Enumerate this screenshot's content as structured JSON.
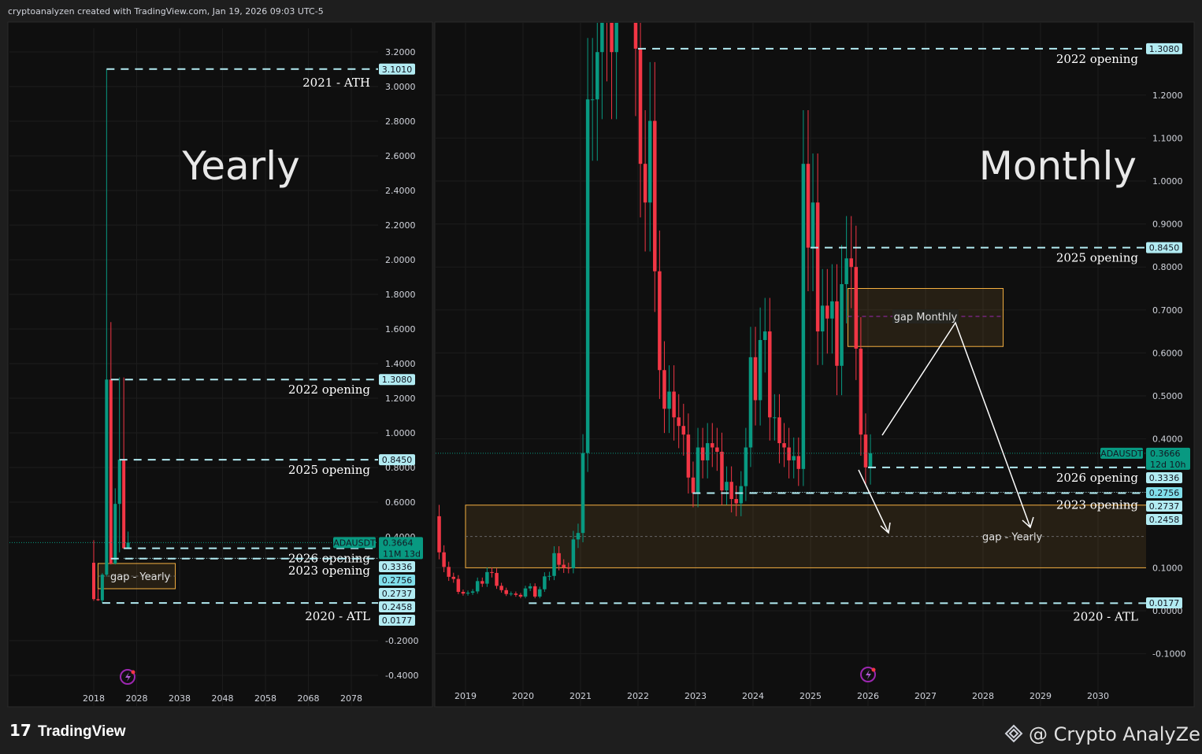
{
  "header": {
    "credit": "cryptoanalyzen created with TradingView.com, Jan 19, 2026 09:03 UTC-5"
  },
  "footer": {
    "logo": "TradingView",
    "watermark": "@ Crypto AnalyZen"
  },
  "colors": {
    "up": "#089981",
    "down": "#f23645",
    "level_line": "#b2ebf2",
    "tag_bg": "#b2ebf2",
    "symbol_tag": "#089981",
    "gap_box": "#f5b041",
    "gap_mid": "#9c27b0"
  },
  "chart_data": [
    {
      "type": "candlestick",
      "title": "Yearly",
      "symbol": "ADAUSDT",
      "timeframe": "1Y",
      "xlim": [
        2016,
        2086
      ],
      "ylim": [
        -0.45,
        3.3
      ],
      "x_ticks": [
        "2018",
        "2028",
        "2038",
        "2048",
        "2058",
        "2068",
        "2078"
      ],
      "y_ticks": [
        "3.2000",
        "3.0000",
        "2.8000",
        "2.6000",
        "2.4000",
        "2.2000",
        "2.0000",
        "1.8000",
        "1.6000",
        "1.4000",
        "1.2000",
        "1.0000",
        "0.8000",
        "0.6000",
        "0.4000",
        "-0.2000",
        "-0.4000"
      ],
      "candles": [
        {
          "t": 2018,
          "o": 0.25,
          "h": 0.38,
          "l": 0.03,
          "c": 0.04
        },
        {
          "t": 2019,
          "o": 0.04,
          "h": 0.1,
          "l": 0.03,
          "c": 0.033
        },
        {
          "t": 2020,
          "o": 0.033,
          "h": 0.19,
          "l": 0.0177,
          "c": 0.181
        },
        {
          "t": 2021,
          "o": 0.181,
          "h": 3.101,
          "l": 0.17,
          "c": 1.308
        },
        {
          "t": 2022,
          "o": 1.308,
          "h": 1.64,
          "l": 0.24,
          "c": 0.245
        },
        {
          "t": 2023,
          "o": 0.245,
          "h": 0.68,
          "l": 0.24,
          "c": 0.59
        },
        {
          "t": 2024,
          "o": 0.59,
          "h": 1.32,
          "l": 0.31,
          "c": 0.845
        },
        {
          "t": 2025,
          "o": 0.845,
          "h": 1.32,
          "l": 0.33,
          "c": 0.3336
        },
        {
          "t": 2026,
          "o": 0.3336,
          "h": 0.43,
          "l": 0.33,
          "c": 0.3664
        }
      ],
      "levels": [
        {
          "price": 3.101,
          "from": 2021,
          "label": "2021 - ATH",
          "tag": "3.1010"
        },
        {
          "price": 1.308,
          "from": 2022,
          "label": "2022 opening",
          "tag": "1.3080"
        },
        {
          "price": 0.845,
          "from": 2024,
          "label": "2025 opening",
          "tag": "0.8450"
        },
        {
          "price": 0.3336,
          "from": 2025,
          "label": "2026 opening",
          "tag": "0.3336"
        },
        {
          "price": 0.2756,
          "from": 2025,
          "label": "",
          "tag": "0.2756",
          "dotted": true
        },
        {
          "price": 0.2737,
          "from": 2022,
          "label": "2023 opening",
          "tag": "0.2737"
        },
        {
          "price": 0.0177,
          "from": 2020,
          "label": "2020 - ATL",
          "tag": "0.0177"
        }
      ],
      "extra_tags": [
        "0.2458"
      ],
      "current": {
        "symbol": "ADAUSDT",
        "price": "0.3664",
        "countdown": "11M 13d",
        "value": 0.3664
      },
      "gap_box": {
        "label": "gap - Yearly",
        "top": 0.2458,
        "bottom": 0.1,
        "from": 2019,
        "to": 2037
      }
    },
    {
      "type": "candlestick",
      "title": "Monthly",
      "symbol": "ADAUSDT",
      "timeframe": "1M",
      "xlim": [
        2018.5,
        2030.9
      ],
      "ylim": [
        -0.2,
        1.37
      ],
      "x_ticks": [
        "2019",
        "2020",
        "2021",
        "2022",
        "2023",
        "2024",
        "2025",
        "2026",
        "2027",
        "2028",
        "2029",
        "2030"
      ],
      "y_ticks": [
        "1.2000",
        "1.1000",
        "1.0000",
        "0.9000",
        "0.8000",
        "0.7000",
        "0.6000",
        "0.5000",
        "0.4000",
        "0.1000",
        "0.0000",
        "-0.1000"
      ],
      "start": "2018-07",
      "first_open": 0.22,
      "closes": [
        0.136,
        0.102,
        0.079,
        0.074,
        0.044,
        0.04,
        0.042,
        0.045,
        0.069,
        0.063,
        0.09,
        0.088,
        0.058,
        0.048,
        0.039,
        0.04,
        0.037,
        0.033,
        0.052,
        0.057,
        0.033,
        0.05,
        0.08,
        0.081,
        0.134,
        0.107,
        0.1,
        0.099,
        0.166,
        0.181,
        0.367,
        1.19,
        1.19,
        1.3,
        1.73,
        1.4,
        1.3,
        2.89,
        2.2,
        2.17,
        1.57,
        1.308,
        1.04,
        0.95,
        1.14,
        0.79,
        0.56,
        0.47,
        0.51,
        0.45,
        0.43,
        0.41,
        0.31,
        0.2737,
        0.38,
        0.35,
        0.39,
        0.38,
        0.37,
        0.28,
        0.3,
        0.26,
        0.25,
        0.29,
        0.38,
        0.59,
        0.49,
        0.63,
        0.65,
        0.45,
        0.45,
        0.39,
        0.38,
        0.35,
        0.36,
        0.33,
        1.04,
        0.845,
        0.95,
        0.65,
        0.71,
        0.68,
        0.72,
        0.57,
        0.76,
        0.82,
        0.8,
        0.61,
        0.41,
        0.3336,
        0.3666
      ],
      "levels": [
        {
          "price": 1.308,
          "from": 2022.0,
          "label": "2022 opening",
          "tag": "1.3080"
        },
        {
          "price": 0.845,
          "from": 2025.0,
          "label": "2025 opening",
          "tag": "0.8450"
        },
        {
          "price": 0.3336,
          "from": 2026.0,
          "label": "2026 opening",
          "tag": "0.3336"
        },
        {
          "price": 0.2756,
          "from": 2023.95,
          "label": "",
          "tag": "0.2756",
          "dotted": true
        },
        {
          "price": 0.2737,
          "from": 2022.95,
          "label": "2023 opening",
          "tag": "0.2737"
        },
        {
          "price": 0.0177,
          "from": 2020.1,
          "label": "2020 - ATL",
          "tag": "0.0177"
        }
      ],
      "extra_tags": [
        "0.2458"
      ],
      "current": {
        "symbol": "ADAUSDT",
        "price": "0.3666",
        "countdown": "12d 10h",
        "value": 0.3666
      },
      "gap_box": {
        "label": "gap - Yearly",
        "top": 0.2458,
        "bottom": 0.1,
        "from": 2019.0,
        "to": 2030.9
      },
      "gap_monthly": {
        "label": "gap Monthly",
        "top": 0.75,
        "bottom": 0.615,
        "mid": 0.685,
        "from": 2025.65,
        "to": 2028.35
      }
    }
  ]
}
